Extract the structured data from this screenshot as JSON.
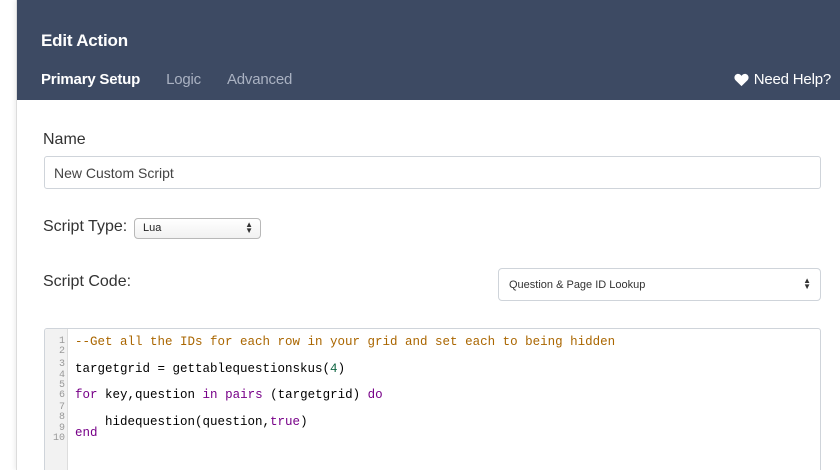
{
  "header": {
    "title": "Edit Action",
    "tabs": [
      "Primary Setup",
      "Logic",
      "Advanced"
    ],
    "help_label": "Need Help?",
    "background": "#3d4a63"
  },
  "form": {
    "name_label": "Name",
    "name_value": "New Custom Script",
    "script_type_label": "Script Type:",
    "script_type_value": "Lua",
    "script_code_label": "Script Code:",
    "lookup_value": "Question & Page ID Lookup"
  },
  "editor": {
    "line_numbers": [
      "1",
      "2",
      "3",
      "4",
      "5",
      "6",
      "7",
      "8",
      "9",
      "10"
    ],
    "line1_comment": "--Get all the IDs for each row in your grid and set each to being hidden",
    "line3_pre": "targetgrid = gettablequestionskus(",
    "line3_num": "4",
    "line3_post": ")",
    "line5_kw1": "for",
    "line5_mid1": " key,question ",
    "line5_kw2": "in",
    "line5_sp": " ",
    "line5_kw3": "pairs",
    "line5_mid2": " (targetgrid) ",
    "line5_kw4": "do",
    "line7_pre": "    hidequestion(question,",
    "line7_kw": "true",
    "line7_post": ")",
    "line8_kw": "end"
  },
  "icons": {
    "help": "heart-icon",
    "select_arrows": "updown-arrows-icon"
  }
}
